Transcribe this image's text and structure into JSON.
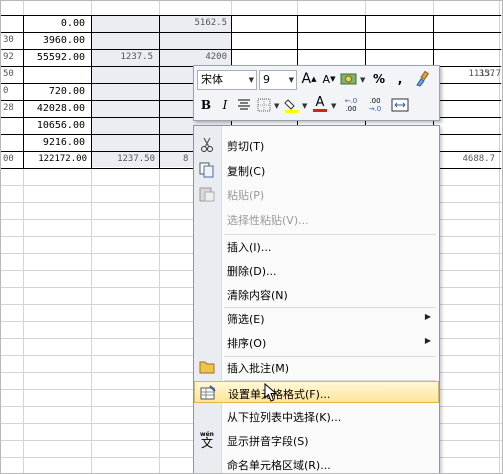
{
  "sheet": {
    "rows": [
      [
        "",
        "0.00",
        "",
        "5162.5",
        "",
        "",
        "",
        ""
      ],
      [
        "30",
        "3960.00",
        "",
        "",
        "",
        "",
        "",
        ""
      ],
      [
        "92",
        "55592.00",
        "1237.5",
        "4200",
        "",
        "",
        "",
        ""
      ],
      [
        "50",
        "",
        "",
        "",
        "",
        "",
        "357",
        ""
      ],
      [
        "0",
        "720.00",
        "",
        "",
        "",
        "",
        "1113.7",
        ""
      ],
      [
        "28",
        "42028.00",
        "",
        "",
        "",
        "",
        "",
        ""
      ],
      [
        "",
        "10656.00",
        "",
        "",
        "",
        "",
        "",
        ""
      ],
      [
        "",
        "9216.00",
        "",
        "",
        "",
        "",
        "",
        ""
      ],
      [
        "00",
        "122172.00",
        "1237.50",
        "8",
        "",
        "",
        "4688.7",
        ""
      ]
    ]
  },
  "mini_toolbar": {
    "font_name": "宋体",
    "font_size": "9",
    "grow_font": "A",
    "shrink_font": "A",
    "percent": "%",
    "comma": ",",
    "bold": "B",
    "italic": "I",
    "font_color_letter": "A",
    "inc_decimal": ".0→.00",
    "dec_decimal": ".00→.0"
  },
  "context_menu": {
    "items": [
      {
        "label": "剪切(T)",
        "icon": "scissors-icon",
        "enabled": true
      },
      {
        "label": "复制(C)",
        "icon": "copy-icon",
        "enabled": true
      },
      {
        "label": "粘贴(P)",
        "icon": "paste-icon",
        "enabled": false
      },
      {
        "label": "选择性粘贴(V)...",
        "icon": "",
        "enabled": false
      },
      {
        "label": "插入(I)...",
        "icon": "",
        "enabled": true
      },
      {
        "label": "删除(D)...",
        "icon": "",
        "enabled": true
      },
      {
        "label": "清除内容(N)",
        "icon": "",
        "enabled": true
      },
      {
        "label": "筛选(E)",
        "icon": "",
        "enabled": true,
        "submenu": true
      },
      {
        "label": "排序(O)",
        "icon": "",
        "enabled": true,
        "submenu": true
      },
      {
        "label": "插入批注(M)",
        "icon": "comment-icon",
        "enabled": true
      },
      {
        "label": "设置单元格格式(F)...",
        "icon": "format-cells-icon",
        "enabled": true,
        "highlighted": true
      },
      {
        "label": "从下拉列表中选择(K)...",
        "icon": "",
        "enabled": true
      },
      {
        "label": "显示拼音字段(S)",
        "icon": "phonetic-icon",
        "enabled": true
      },
      {
        "label": "命名单元格区域(R)...",
        "icon": "",
        "enabled": true
      }
    ]
  },
  "colors": {
    "highlight": "#fde59a",
    "selection_shade": "#ecedf2",
    "menu_gutter": "#e9ecf1"
  }
}
